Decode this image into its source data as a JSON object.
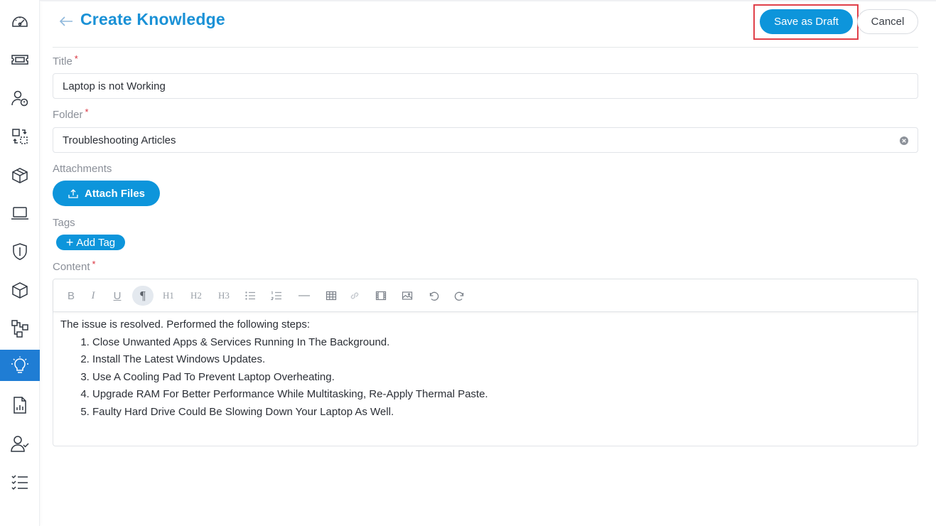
{
  "header": {
    "title": "Create Knowledge",
    "save_draft_label": "Save as Draft",
    "cancel_label": "Cancel"
  },
  "sidebar": {
    "items": [
      {
        "icon": "dashboard-icon",
        "active": false
      },
      {
        "icon": "ticket-icon",
        "active": false
      },
      {
        "icon": "user-alert-icon",
        "active": false
      },
      {
        "icon": "change-icon",
        "active": false
      },
      {
        "icon": "assets-icon",
        "active": false
      },
      {
        "icon": "laptop-icon",
        "active": false
      },
      {
        "icon": "shield-icon",
        "active": false
      },
      {
        "icon": "box-icon",
        "active": false
      },
      {
        "icon": "workflow-icon",
        "active": false
      },
      {
        "icon": "lightbulb-icon",
        "active": true
      },
      {
        "icon": "report-icon",
        "active": false
      },
      {
        "icon": "user-check-icon",
        "active": false
      },
      {
        "icon": "checklist-icon",
        "active": false
      }
    ]
  },
  "form": {
    "title_label": "Title",
    "title_value": "Laptop is not Working",
    "folder_label": "Folder",
    "folder_value": "Troubleshooting Articles",
    "attachments_label": "Attachments",
    "attach_button_label": "Attach Files",
    "tags_label": "Tags",
    "add_tag_label": "Add Tag",
    "content_label": "Content",
    "required_mark": "*"
  },
  "editor": {
    "toolbar": [
      "bold",
      "italic",
      "underline",
      "paragraph",
      "heading-1",
      "heading-2",
      "heading-3",
      "bullet-list",
      "ordered-list",
      "horizontal-rule",
      "table",
      "link",
      "video",
      "image",
      "undo",
      "redo"
    ],
    "toolbar_text": {
      "h1": "H1",
      "h2": "H2",
      "h3": "H3",
      "b": "B",
      "i": "I",
      "u": "U"
    },
    "intro": "The issue is resolved. Performed the following steps:",
    "steps": [
      "Close Unwanted Apps & Services Running In The Background.",
      "Install The Latest Windows Updates.",
      "Use A Cooling Pad To Prevent Laptop Overheating.",
      "Upgrade RAM For Better Performance While Multitasking, Re-Apply Thermal Paste.",
      "Faulty Hard Drive Could Be Slowing Down Your Laptop As Well."
    ]
  },
  "colors": {
    "accent": "#0d95db",
    "title": "#1a91d6",
    "sidebar_active": "#1f7dd4",
    "required": "#d9333f",
    "highlight": "#e0404a"
  }
}
